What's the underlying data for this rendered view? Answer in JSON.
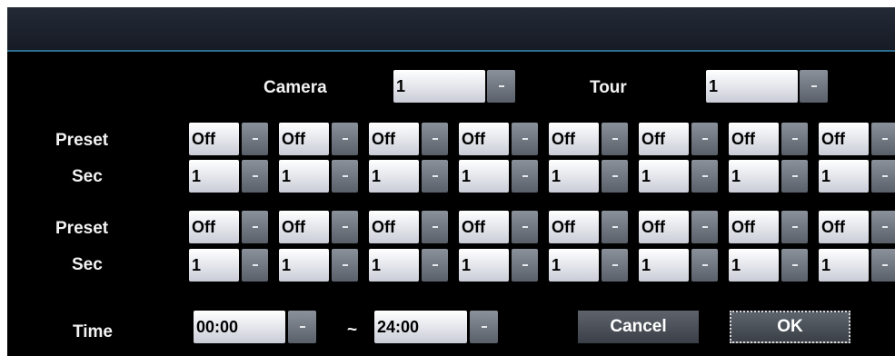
{
  "camera": {
    "label": "Camera",
    "value": "1"
  },
  "tour": {
    "label": "Tour",
    "value": "1"
  },
  "groups": [
    {
      "preset_label": "Preset",
      "sec_label": "Sec",
      "presets": [
        "Off",
        "Off",
        "Off",
        "Off",
        "Off",
        "Off",
        "Off",
        "Off"
      ],
      "secs": [
        "1",
        "1",
        "1",
        "1",
        "1",
        "1",
        "1",
        "1"
      ]
    },
    {
      "preset_label": "Preset",
      "sec_label": "Sec",
      "presets": [
        "Off",
        "Off",
        "Off",
        "Off",
        "Off",
        "Off",
        "Off",
        "Off"
      ],
      "secs": [
        "1",
        "1",
        "1",
        "1",
        "1",
        "1",
        "1",
        "1"
      ]
    }
  ],
  "time": {
    "label": "Time",
    "start": "00:00",
    "separator": "~",
    "end": "24:00"
  },
  "buttons": {
    "cancel": "Cancel",
    "ok": "OK"
  },
  "colors": {
    "background": "#000000",
    "field": "#dcdee6",
    "dropdown_button": "#6f757e",
    "title_border": "#2c6f92"
  }
}
